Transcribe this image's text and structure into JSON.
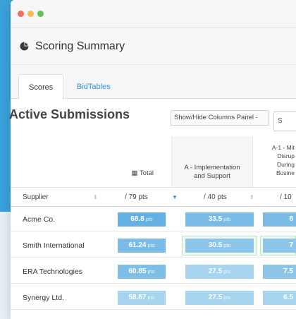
{
  "window": {
    "traffic_lights": [
      "close",
      "minimize",
      "maximize"
    ]
  },
  "header": {
    "icon": "pie-chart-icon",
    "title": "Scoring Summary"
  },
  "tabs": [
    {
      "label": "Scores",
      "active": true
    },
    {
      "label": "BidTables",
      "active": false
    }
  ],
  "section": {
    "title": "Active Submissions",
    "columns_button": "Show/Hide Columns Panel -",
    "search_placeholder": "S"
  },
  "table": {
    "column_headers": {
      "total": "▦ Total",
      "a_line1": "A - Implementation",
      "a_line2": "and Support",
      "a1_lines": [
        "A-1 - Mit",
        "Disrup",
        "During",
        "Busine"
      ]
    },
    "sub_headers": {
      "supplier": "Supplier",
      "total_pts": "/ 79 pts",
      "a_pts": "/ 40 pts",
      "a1_pts": "/ 10"
    },
    "unit": "pts",
    "rows": [
      {
        "supplier": "Acme Co.",
        "total": "68.8",
        "a": "33.5",
        "a1": "8"
      },
      {
        "supplier": "Smith International",
        "total": "61.24",
        "a": "30.5",
        "a1": "7"
      },
      {
        "supplier": "ERA Technologies",
        "total": "60.85",
        "a": "27.5",
        "a1": "7.5"
      },
      {
        "supplier": "Synergy Ltd.",
        "total": "58.67",
        "a": "27.5",
        "a1": "6.5"
      }
    ]
  },
  "colors": {
    "page_background": "#3aa3dc",
    "link": "#3b8ed0",
    "score_pill_shades": [
      "#63b0e2",
      "#7abce6",
      "#8ec6e9",
      "#a6d3ee"
    ],
    "highlight": "#b8e3c2"
  }
}
